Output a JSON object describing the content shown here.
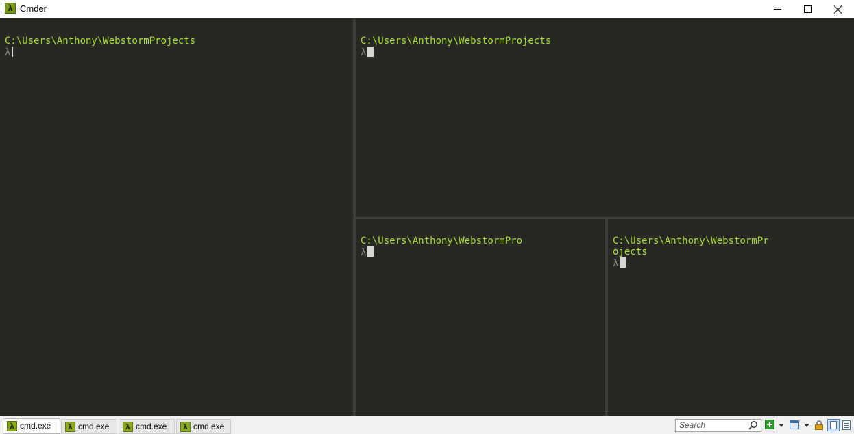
{
  "window": {
    "title": "Cmder"
  },
  "panes": [
    {
      "id": "left",
      "path": "C:\\Users\\Anthony\\WebstormProjects",
      "prompt": "λ"
    },
    {
      "id": "top-right",
      "path": "C:\\Users\\Anthony\\WebstormProjects",
      "prompt": "λ"
    },
    {
      "id": "bottom-middle",
      "path": "C:\\Users\\Anthony\\WebstormPro",
      "prompt": "λ"
    },
    {
      "id": "bottom-right",
      "path": "C:\\Users\\Anthony\\WebstormPr\nojects",
      "prompt": "λ"
    }
  ],
  "tabs": [
    {
      "label": "cmd.exe",
      "icon": "lambda-icon",
      "active": true
    },
    {
      "label": "cmd.exe",
      "icon": "lambda-icon",
      "active": false
    },
    {
      "label": "cmd.exe",
      "icon": "lambda-icon",
      "active": false
    },
    {
      "label": "cmd.exe",
      "icon": "lambda-icon",
      "active": false
    }
  ],
  "toolbar": {
    "search_placeholder": "Search",
    "icons": [
      "search-icon",
      "new-console-icon",
      "layout-icon",
      "lock-icon",
      "view-icon",
      "menu-icon"
    ]
  },
  "colors": {
    "background": "#272822",
    "path": "#a6e22e",
    "prompt": "#8a8a80",
    "accent": "#8aa81e"
  }
}
